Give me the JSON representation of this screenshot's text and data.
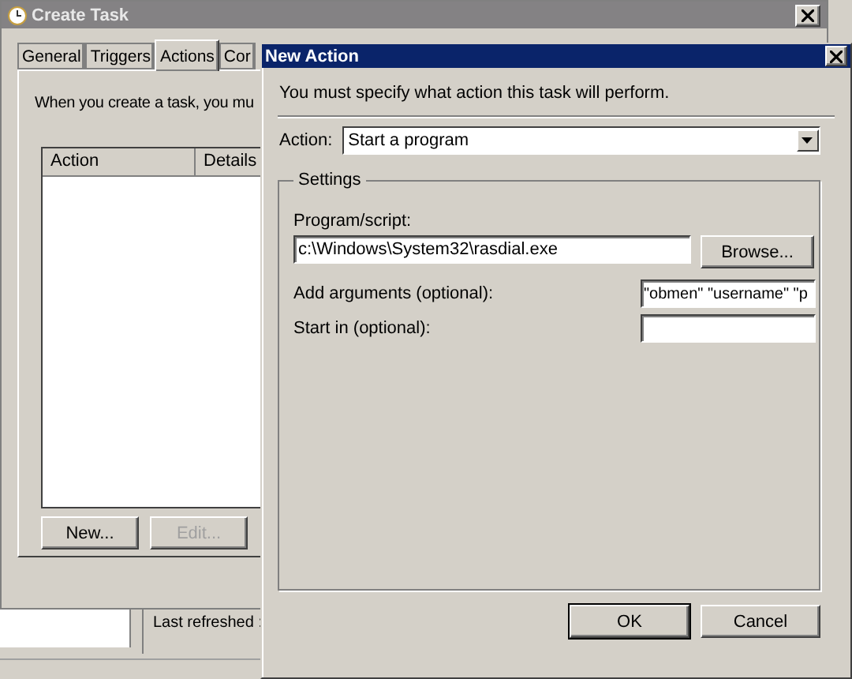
{
  "create_task": {
    "title": "Create Task",
    "tabs": [
      {
        "label": "General",
        "selected": false
      },
      {
        "label": "Triggers",
        "selected": false
      },
      {
        "label": "Actions",
        "selected": true
      },
      {
        "label": "Cor",
        "selected": false
      }
    ],
    "intro": "When you create a task, you mu",
    "list": {
      "columns": [
        "Action",
        "Details"
      ]
    },
    "buttons": [
      {
        "label": "New...",
        "disabled": false
      },
      {
        "label": "Edit...",
        "disabled": true
      }
    ]
  },
  "background_window": {
    "status": "Last refreshed :"
  },
  "new_action": {
    "title": "New Action",
    "instruction": "You must specify what action this task will perform.",
    "action": {
      "label": "Action:",
      "value": "Start a program"
    },
    "settings": {
      "title": "Settings",
      "program": {
        "label": "Program/script:",
        "value": "c:\\Windows\\System32\\rasdial.exe",
        "button": "Browse..."
      },
      "arguments": {
        "label": "Add arguments (optional):",
        "value": "\"obmen\" \"username\" \"p"
      },
      "start_in": {
        "label": "Start in (optional):"
      }
    },
    "buttons": [
      "OK",
      "Cancel"
    ]
  }
}
